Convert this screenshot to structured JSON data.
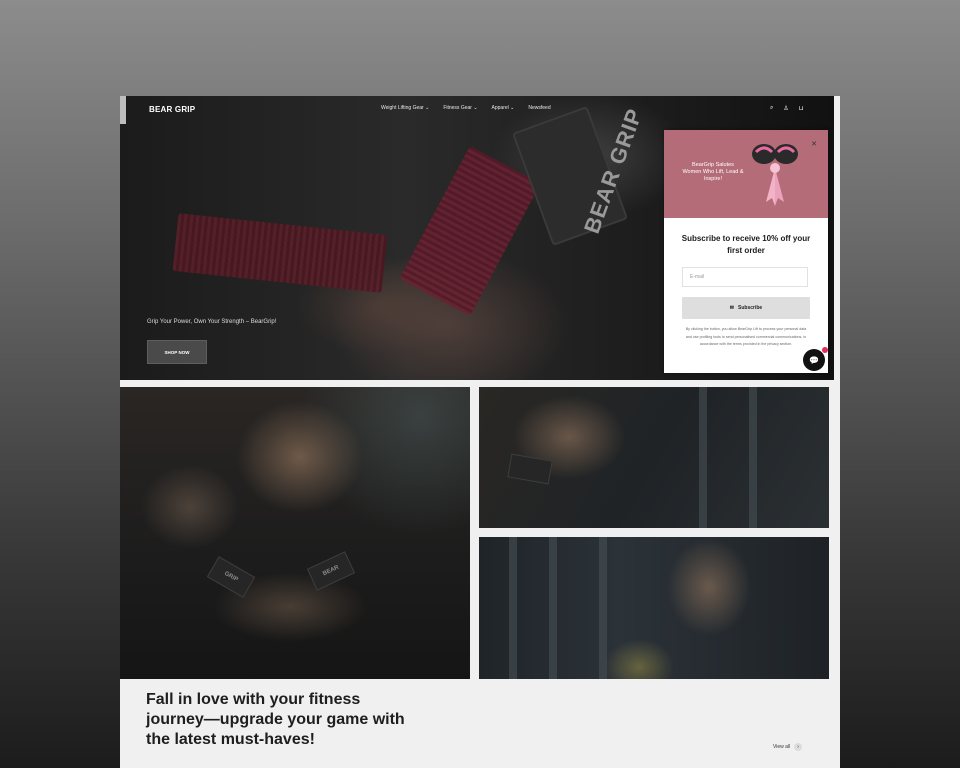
{
  "header": {
    "logo": "BEAR GRIP",
    "nav": [
      "Weight Lifting Gear",
      "Fitness Gear",
      "Apparel",
      "Newsfeed"
    ],
    "icons": [
      "search-icon",
      "account-icon",
      "cart-icon"
    ]
  },
  "hero": {
    "tagline": "Grip Your Power, Own Your Strength – BearGrip!",
    "cta": "SHOP NOW",
    "strap_logo": "BEAR GRIP"
  },
  "popup": {
    "banner_text": "BearGrip Salutes Women Who Lift, Lead & Inspire!",
    "heading": "Subscribe to receive 10% off your first order",
    "email_placeholder": "E-mail",
    "subscribe_label": "Subscribe",
    "legal": "By clicking the button, you allow BearGrip Lift to process your personal data and use profiling tools to send personalised commercial communications, in accordance with the terms provided in the privacy section."
  },
  "collection": {
    "heading": "Fall in love with your fitness journey—upgrade your game with the latest must-haves!",
    "view_all": "View all"
  },
  "colors": {
    "popup_banner": "#b56c79",
    "accent_pink": "#e02b5c"
  }
}
